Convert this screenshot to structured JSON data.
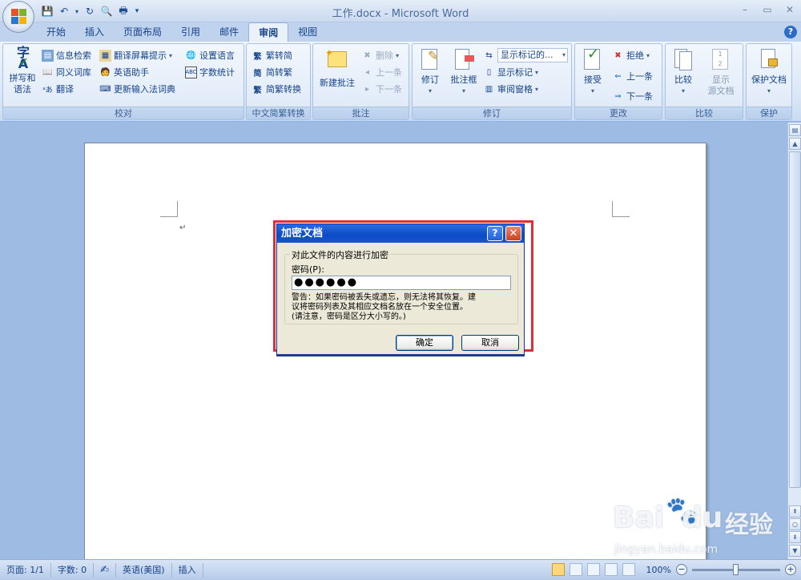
{
  "window": {
    "title": "工作.docx - Microsoft Word"
  },
  "tabs": [
    "开始",
    "插入",
    "页面布局",
    "引用",
    "邮件",
    "审阅",
    "视图"
  ],
  "active_tab": "审阅",
  "ribbon": {
    "proofing": {
      "label": "校对",
      "spelling": "拼写和\n语法",
      "spelling_line1": "拼写和",
      "spelling_line2": "语法",
      "research": "信息检索",
      "thesaurus": "同义词库",
      "translate": "翻译",
      "translate_tip": "翻译屏幕提示",
      "english_assistant": "英语助手",
      "update_ime": "更新输入法词典",
      "set_language": "设置语言",
      "word_count": "字数统计"
    },
    "chinese_conversion": {
      "label": "中文简繁转换",
      "to_simplified": "繁转简",
      "to_traditional": "简转繁",
      "convert": "简繁转换"
    },
    "comments": {
      "label": "批注",
      "new_comment": "新建批注",
      "delete": "删除",
      "previous": "上一条",
      "next": "下一条"
    },
    "tracking": {
      "label": "修订",
      "track_changes": "修订",
      "balloons": "批注框",
      "display_select": "显示标记的...",
      "show_markup": "显示标记",
      "reviewing_pane": "审阅窗格"
    },
    "changes": {
      "label": "更改",
      "accept": "接受",
      "reject": "拒绝",
      "previous": "上一条",
      "next": "下一条"
    },
    "compare": {
      "label": "比较",
      "compare": "比较",
      "show_source_line1": "显示",
      "show_source_line2": "源文档"
    },
    "protect": {
      "label": "保护",
      "protect_document": "保护文档"
    }
  },
  "dialog": {
    "title": "加密文档",
    "group_legend": "对此文件的内容进行加密",
    "password_label": "密码(P):",
    "password_value": "●●●●●●",
    "warning_line1": "警告：如果密码被丢失或遗忘，则无法将其恢复。建",
    "warning_line2": "议将密码列表及其相应文档名放在一个安全位置。",
    "warning_line3": "(请注意，密码是区分大小写的。)",
    "ok": "确定",
    "cancel": "取消"
  },
  "statusbar": {
    "page": "页面: 1/1",
    "words": "字数: 0",
    "language": "英语(美国)",
    "mode": "插入",
    "zoom": "100%"
  },
  "watermark": {
    "brand": "Bai",
    "brand2": "du",
    "cn": "经验",
    "url": "jingyan.baidu.com"
  },
  "colors": {
    "ribbon_bg": "#dae6f6",
    "accent": "#15428b",
    "dialog_title": "#0a4bc8",
    "highlight": "#d9303a"
  }
}
